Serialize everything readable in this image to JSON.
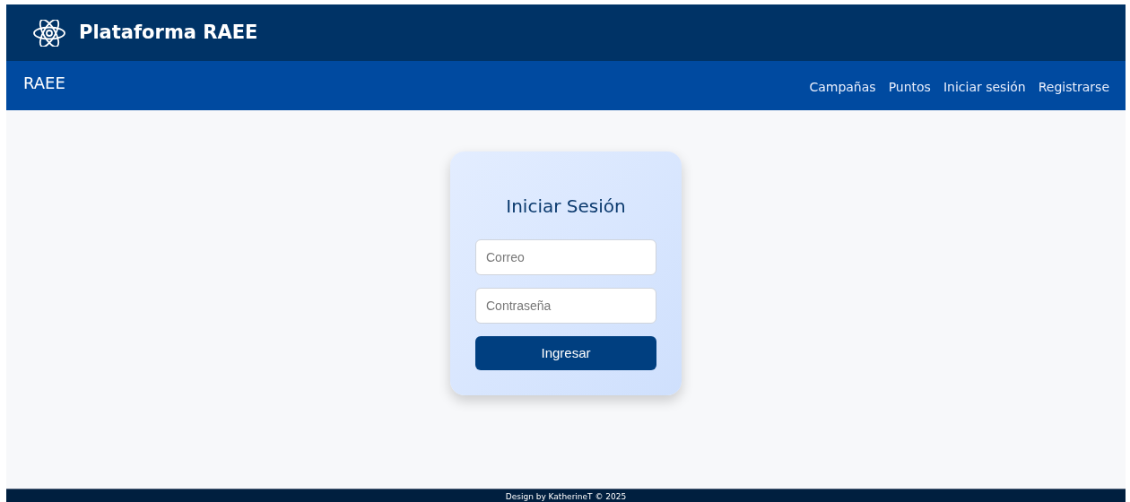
{
  "header": {
    "title": "Plataforma RAEE"
  },
  "navbar": {
    "brand": "RAEE",
    "links": [
      "Campañas",
      "Puntos",
      "Iniciar sesión",
      "Registrarse"
    ]
  },
  "login": {
    "title": "Iniciar Sesión",
    "fields": [
      {
        "placeholder": "Correo"
      },
      {
        "placeholder": "Contraseña"
      }
    ],
    "button": "Ingresar"
  },
  "footer": {
    "text": "Design by KatherineT © 2025"
  }
}
